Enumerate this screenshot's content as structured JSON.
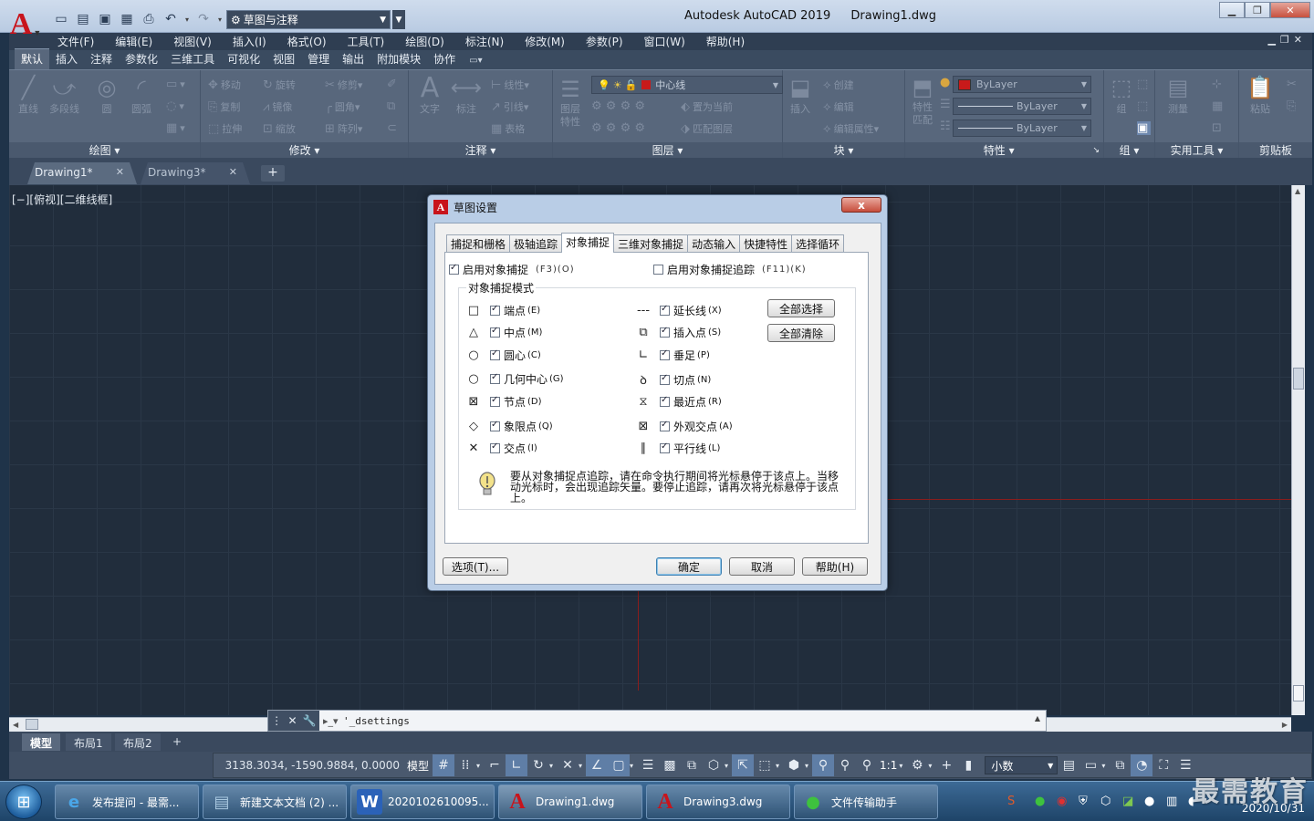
{
  "titlebar": {
    "app_title": "Autodesk AutoCAD 2019",
    "file_title": "Drawing1.dwg",
    "workspace": "草图与注释",
    "window_controls": [
      "minimize-icon",
      "restore-icon",
      "close-icon"
    ]
  },
  "menubar": {
    "items": [
      "文件(F)",
      "编辑(E)",
      "视图(V)",
      "插入(I)",
      "格式(O)",
      "工具(T)",
      "绘图(D)",
      "标注(N)",
      "修改(M)",
      "参数(P)",
      "窗口(W)",
      "帮助(H)"
    ]
  },
  "ribbon_tabs": {
    "items": [
      "默认",
      "插入",
      "注释",
      "参数化",
      "三维工具",
      "可视化",
      "视图",
      "管理",
      "输出",
      "附加模块",
      "协作"
    ],
    "active": "默认"
  },
  "ribbon": {
    "draw": {
      "title": "绘图",
      "line": "直线",
      "polyline": "多段线",
      "circle": "圆",
      "arc": "圆弧"
    },
    "modify": {
      "title": "修改",
      "move": "移动",
      "rotate": "旋转",
      "trim": "修剪",
      "copy": "复制",
      "mirror": "镜像",
      "fillet": "圆角",
      "stretch": "拉伸",
      "scale": "缩放",
      "array": "阵列"
    },
    "annotation": {
      "title": "注释",
      "text": "文字",
      "dimension": "标注",
      "linear": "线性",
      "leader": "引线",
      "table": "表格"
    },
    "layers": {
      "title": "图层",
      "layer_properties": "图层特性",
      "current_layer": "中心线",
      "set_current": "置为当前",
      "match_layer": "匹配图层"
    },
    "block": {
      "title": "块",
      "insert": "插入",
      "create": "创建",
      "edit": "编辑",
      "edit_attributes": "编辑属性"
    },
    "properties": {
      "title": "特性",
      "match_properties": "特性匹配",
      "color": "ByLayer",
      "linetype": "ByLayer",
      "lineweight": "ByLayer"
    },
    "groups": {
      "title": "组",
      "group": "组"
    },
    "utilities": {
      "title": "实用工具",
      "measure": "测量"
    },
    "clipboard": {
      "title": "剪贴板",
      "paste": "粘贴"
    }
  },
  "file_tabs": {
    "items": [
      "Drawing1*",
      "Drawing3*"
    ],
    "new_tab": "+"
  },
  "drawing": {
    "view_label": "[−][俯视][二维线框]"
  },
  "cmdline": {
    "text": "'_dsettings"
  },
  "layout_tabs": {
    "items": [
      "模型",
      "布局1",
      "布局2"
    ],
    "add": "+"
  },
  "statusbar": {
    "coords": "3138.3034, -1590.9884, 0.0000",
    "model": "模型",
    "scale": "1:1",
    "units": "小数"
  },
  "dialog": {
    "title": "草图设置",
    "close_label": "x",
    "tabs": [
      "捕捉和栅格",
      "极轴追踪",
      "对象捕捉",
      "三维对象捕捉",
      "动态输入",
      "快捷特性",
      "选择循环"
    ],
    "active_tab": "对象捕捉",
    "enable_osnap": {
      "label": "启用对象捕捉",
      "key": "(F3)(O)",
      "checked": true
    },
    "enable_tracking": {
      "label": "启用对象捕捉追踪",
      "key": "(F11)(K)",
      "checked": false
    },
    "group_label": "对象捕捉模式",
    "modes_left": [
      {
        "symbol": "□",
        "label": "端点",
        "key": "(E)",
        "checked": true
      },
      {
        "symbol": "△",
        "label": "中点",
        "key": "(M)",
        "checked": true
      },
      {
        "symbol": "○",
        "label": "圆心",
        "key": "(C)",
        "checked": true
      },
      {
        "symbol": "○",
        "label": "几何中心",
        "key": "(G)",
        "checked": true
      },
      {
        "symbol": "⊠",
        "label": "节点",
        "key": "(D)",
        "checked": true
      },
      {
        "symbol": "◇",
        "label": "象限点",
        "key": "(Q)",
        "checked": true
      },
      {
        "symbol": "✕",
        "label": "交点",
        "key": "(I)",
        "checked": true
      }
    ],
    "modes_right": [
      {
        "symbol": "---",
        "label": "延长线",
        "key": "(X)",
        "checked": true
      },
      {
        "symbol": "⧉",
        "label": "插入点",
        "key": "(S)",
        "checked": true
      },
      {
        "symbol": "∟",
        "label": "垂足",
        "key": "(P)",
        "checked": true
      },
      {
        "symbol": "ꝺ",
        "label": "切点",
        "key": "(N)",
        "checked": true
      },
      {
        "symbol": "⧖",
        "label": "最近点",
        "key": "(R)",
        "checked": true
      },
      {
        "symbol": "⊠",
        "label": "外观交点",
        "key": "(A)",
        "checked": true
      },
      {
        "symbol": "∥",
        "label": "平行线",
        "key": "(L)",
        "checked": true
      }
    ],
    "select_all": "全部选择",
    "clear_all": "全部清除",
    "hint": "要从对象捕捉点追踪，请在命令执行期间将光标悬停于该点上。当移动光标时，会出现追踪矢量。要停止追踪，请再次将光标悬停于该点上。",
    "options_button": "选项(T)...",
    "ok_button": "确定",
    "cancel_button": "取消",
    "help_button": "帮助(H)"
  },
  "taskbar": {
    "tasks": [
      {
        "icon": "ie-icon",
        "label": "发布提问 - 最需..."
      },
      {
        "icon": "notepad-icon",
        "label": "新建文本文档 (2) ..."
      },
      {
        "icon": "word-icon",
        "label": "2020102610095..."
      },
      {
        "icon": "autocad-icon",
        "label": "Drawing1.dwg"
      },
      {
        "icon": "autocad-icon",
        "label": "Drawing3.dwg"
      },
      {
        "icon": "wechat-icon",
        "label": "文件传输助手"
      }
    ],
    "date": "2020/10/31"
  },
  "watermark": "最需教育",
  "colors": {
    "accent_red": "#c8141c",
    "canvas": "#212d3c",
    "ribbon": "#58677c"
  }
}
